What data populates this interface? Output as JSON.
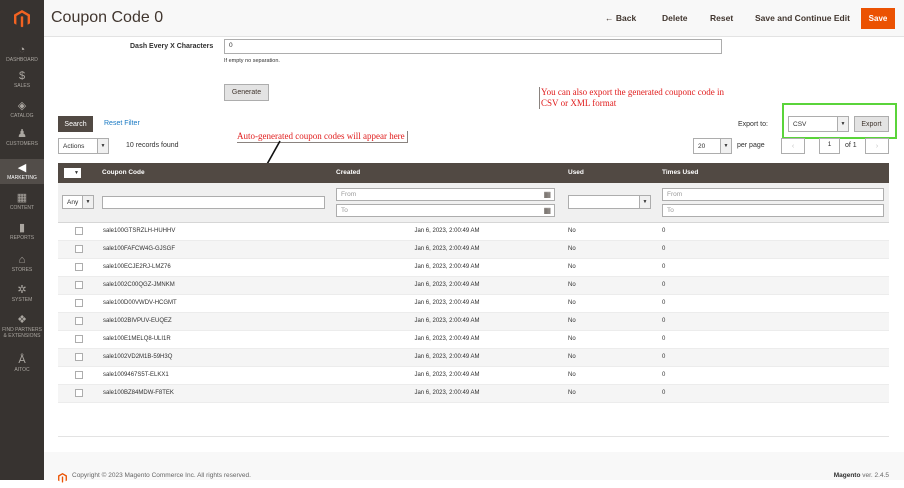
{
  "sidebar": {
    "items": [
      {
        "label": "DASHBOARD",
        "icon": "dashboard-icon",
        "glyph": "◔"
      },
      {
        "label": "SALES",
        "icon": "dollar-icon",
        "glyph": "$"
      },
      {
        "label": "CATALOG",
        "icon": "cube-icon",
        "glyph": "◈"
      },
      {
        "label": "CUSTOMERS",
        "icon": "person-icon",
        "glyph": "♟"
      },
      {
        "label": "MARKETING",
        "icon": "megaphone-icon",
        "glyph": "◀"
      },
      {
        "label": "CONTENT",
        "icon": "layout-icon",
        "glyph": "▦"
      },
      {
        "label": "REPORTS",
        "icon": "bar-chart-icon",
        "glyph": "▮"
      },
      {
        "label": "STORES",
        "icon": "store-icon",
        "glyph": "⌂"
      },
      {
        "label": "SYSTEM",
        "icon": "gear-icon",
        "glyph": "✲"
      },
      {
        "label": "FIND PARTNERS & EXTENSIONS",
        "icon": "puzzle-icon",
        "glyph": "❖"
      },
      {
        "label": "AITOC",
        "icon": "aitoc-icon",
        "glyph": "Å"
      }
    ]
  },
  "header": {
    "title": "Coupon Code 0",
    "back": "← Back",
    "delete": "Delete",
    "reset": "Reset",
    "save_continue": "Save and Continue Edit",
    "save": "Save"
  },
  "form": {
    "dash_label": "Dash Every X Characters",
    "dash_value": "0",
    "dash_note": "If empty no separation.",
    "generate": "Generate"
  },
  "annotations": {
    "export_note_line1": "You can also export the generated couponc code in",
    "export_note_line2": "CSV or XML format",
    "codes_note": "Auto-generated coupon codes will appear here"
  },
  "toolbar": {
    "search": "Search",
    "reset_filter": "Reset Filter",
    "export_to": "Export to:",
    "export_format": "CSV",
    "export": "Export",
    "actions": "Actions",
    "records": "10 records found",
    "per_page_value": "20",
    "per_page": "per page",
    "page": "1",
    "of": "of 1"
  },
  "grid": {
    "columns": [
      "Coupon Code",
      "Created",
      "Used",
      "Times Used"
    ],
    "filters": {
      "any": "Any",
      "from": "From",
      "to": "To"
    },
    "rows": [
      {
        "code": "sale100GTSRZLH-HUHHV",
        "created": "Jan 6, 2023, 2:00:49 AM",
        "used": "No",
        "times": "0"
      },
      {
        "code": "sale100FAFCW4G-GJSGF",
        "created": "Jan 6, 2023, 2:00:49 AM",
        "used": "No",
        "times": "0"
      },
      {
        "code": "sale100ECJE2RJ-LMZ76",
        "created": "Jan 6, 2023, 2:00:49 AM",
        "used": "No",
        "times": "0"
      },
      {
        "code": "sale1002C00QGZ-JMNKM",
        "created": "Jan 6, 2023, 2:00:49 AM",
        "used": "No",
        "times": "0"
      },
      {
        "code": "sale100D00VWDV-HCGMT",
        "created": "Jan 6, 2023, 2:00:49 AM",
        "used": "No",
        "times": "0"
      },
      {
        "code": "sale1002BIVPUV-EUQEZ",
        "created": "Jan 6, 2023, 2:00:49 AM",
        "used": "No",
        "times": "0"
      },
      {
        "code": "sale100E1MELQ8-ULI1R",
        "created": "Jan 6, 2023, 2:00:49 AM",
        "used": "No",
        "times": "0"
      },
      {
        "code": "sale1002VD2M1B-59H3Q",
        "created": "Jan 6, 2023, 2:00:49 AM",
        "used": "No",
        "times": "0"
      },
      {
        "code": "sale1009467S5T-ELKX1",
        "created": "Jan 6, 2023, 2:00:49 AM",
        "used": "No",
        "times": "0"
      },
      {
        "code": "sale100BZ84MDW-F8TEK",
        "created": "Jan 6, 2023, 2:00:49 AM",
        "used": "No",
        "times": "0"
      }
    ]
  },
  "footer": {
    "copyright": "Copyright © 2023 Magento Commerce Inc. All rights reserved.",
    "brand": "Magento",
    "version": "ver. 2.4.5"
  },
  "colors": {
    "accent": "#eb5202",
    "sidebar": "#373330",
    "grid_header": "#514943",
    "annotation": "#e01b1b",
    "highlight": "#5ad43a"
  }
}
